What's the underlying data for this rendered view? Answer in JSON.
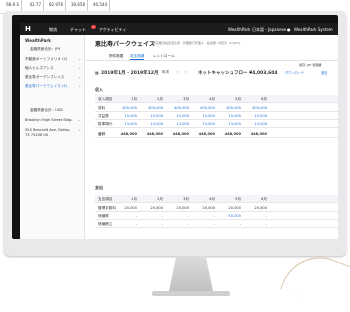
{
  "background_sheet": {
    "cells": [
      "68.9 S",
      "42.77",
      "82.976",
      "30,658",
      "40,544"
    ]
  },
  "topbar": {
    "logo": "H",
    "nav": [
      "物流",
      "チャット",
      "アクティビティ"
    ],
    "chat_badge": "2",
    "center_link": "WealthPark",
    "language": "日本語 - Japanese",
    "user": "WealthPark System"
  },
  "sidebar": {
    "brand": "WealthPark",
    "items": [
      {
        "label": "金融資産合計：JPY",
        "expand": false
      },
      {
        "label": "不動産ポートフォリオ (2)",
        "expand": true
      },
      {
        "label": "個人ヒルズアンス",
        "expand": true
      },
      {
        "label": "恵比寿ガーデンプレイス",
        "expand": true
      },
      {
        "label": "恵比寿パークウェイス (4)",
        "expand": true,
        "active": true
      },
      {
        "label": "金融資産合計：USD",
        "expand": false
      },
      {
        "label": "Brooklyn High Street Bldg.",
        "expand": true
      },
      {
        "label": "555 Bancroft Ave, Dallas, TX 75206 US",
        "expand": true
      }
    ]
  },
  "main": {
    "title": "恵比寿パークウェイス",
    "subtitle": "東京都渋谷区恵比寿 · 管理部门代理人 · 投資額 / 利回り (5.64%)",
    "tabs": [
      "物件概要",
      "収支実績",
      "レントロール"
    ],
    "currency_label": "通貨: JPY  管理費",
    "period": "2019年1月 - 2019年12月",
    "year_button": "年次",
    "cashflow_label": "ネットキャッシュフロー ¥4,003,604",
    "download": "ダウンロード",
    "add": "追加",
    "income_section": "収入",
    "income_header": {
      "label": "収入項目",
      "months": [
        "1月",
        "2月",
        "3月",
        "4月",
        "5月",
        "6月"
      ]
    },
    "income_rows": [
      {
        "label": "賃料",
        "values": [
          "400,000",
          "400,000",
          "400,000",
          "400,000",
          "400,000",
          "400,000"
        ]
      },
      {
        "label": "共益費",
        "values": [
          "15,000",
          "15,000",
          "15,000",
          "15,000",
          "15,000",
          "15,000"
        ]
      },
      {
        "label": "駐車場代",
        "values": [
          "13,000",
          "13,000",
          "13,000",
          "13,000",
          "13,000",
          "13,000"
        ]
      },
      {
        "label": "合計",
        "values": [
          "448,000",
          "448,000",
          "448,000",
          "448,000",
          "448,000",
          "448,000"
        ]
      }
    ],
    "expense_section": "支出",
    "expense_header": {
      "label": "支出項目",
      "months": [
        "1月",
        "2月",
        "3月",
        "4月",
        "5月",
        "6月"
      ]
    },
    "expense_rows": [
      {
        "label": "管理手数料",
        "values": [
          "20,000",
          "20,000",
          "20,000",
          "20,000",
          "20,000",
          "20,000"
        ]
      },
      {
        "label": "修繕費",
        "values": [
          "-",
          "-",
          "-",
          "-",
          "50,000",
          "-"
        ]
      },
      {
        "label": "修繕積立",
        "values": [
          "-",
          "-",
          "-",
          "-",
          "-",
          "-"
        ]
      }
    ]
  }
}
